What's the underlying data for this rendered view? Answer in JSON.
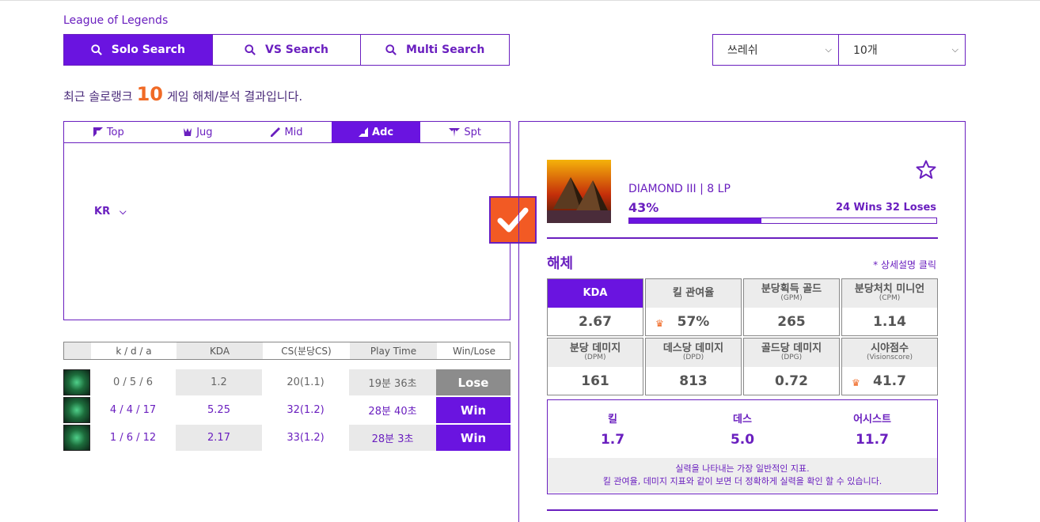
{
  "app": {
    "title": "League of Legends"
  },
  "modes": [
    {
      "label": "Solo Search",
      "active": true
    },
    {
      "label": "VS Search",
      "active": false
    },
    {
      "label": "Multi Search",
      "active": false
    }
  ],
  "filters": {
    "queue": "쓰레쉬",
    "count": "10개"
  },
  "summary": {
    "prefix": "최근 솔로랭크",
    "count": "10",
    "suffix": "게임 해체/분석 결과입니다."
  },
  "lanes": [
    {
      "label": "Top",
      "active": false
    },
    {
      "label": "Jug",
      "active": false
    },
    {
      "label": "Mid",
      "active": false
    },
    {
      "label": "Adc",
      "active": true
    },
    {
      "label": "Spt",
      "active": false
    }
  ],
  "region": "KR",
  "matches": {
    "headers": [
      "k / d / a",
      "KDA",
      "CS(분당CS)",
      "Play Time",
      "Win/Lose"
    ],
    "rows": [
      {
        "kda_line": "0 / 5 / 6",
        "kda": "1.2",
        "cs": "20(1.1)",
        "time": "19분 36초",
        "result": "Lose"
      },
      {
        "kda_line": "4 / 4 / 17",
        "kda": "5.25",
        "cs": "32(1.2)",
        "time": "28분 40초",
        "result": "Win"
      },
      {
        "kda_line": "1 / 6 / 12",
        "kda": "2.17",
        "cs": "33(1.2)",
        "time": "28분 3초",
        "result": "Win"
      }
    ]
  },
  "profile": {
    "rank": "DIAMOND III | 8 LP",
    "winrate_label": "43%",
    "winrate": 0.43,
    "record": "24 Wins 32 Loses"
  },
  "breakdown": {
    "title": "해체",
    "link": "* 상세설명 클릭",
    "stats": [
      {
        "label": "KDA",
        "sub": "",
        "value": "2.67",
        "crown": false,
        "active": true
      },
      {
        "label": "킬 관여율",
        "sub": "",
        "value": "57%",
        "crown": true,
        "active": false
      },
      {
        "label": "분당획득 골드",
        "sub": "(GPM)",
        "value": "265",
        "crown": false,
        "active": false
      },
      {
        "label": "분당처치 미니언",
        "sub": "(CPM)",
        "value": "1.14",
        "crown": false,
        "active": false
      },
      {
        "label": "분당 데미지",
        "sub": "(DPM)",
        "value": "161",
        "crown": false,
        "active": false
      },
      {
        "label": "데스당 데미지",
        "sub": "(DPD)",
        "value": "813",
        "crown": false,
        "active": false
      },
      {
        "label": "골드당 데미지",
        "sub": "(DPG)",
        "value": "0.72",
        "crown": false,
        "active": false
      },
      {
        "label": "시야점수",
        "sub": "(Visionscore)",
        "value": "41.7",
        "crown": true,
        "active": false
      }
    ],
    "kda_detail": {
      "kills_label": "킬",
      "kills": "1.7",
      "deaths_label": "데스",
      "deaths": "5.0",
      "assists_label": "어시스트",
      "assists": "11.7",
      "note_line1": "실력을 나타내는 가장 일반적인 지표.",
      "note_line2": "킬 관여율, 데미지 지표와 같이 보면 더 정확하게 실력을 확인 할 수 있습니다."
    }
  },
  "colors": {
    "accent": "#6a14e0",
    "orange": "#f25a24",
    "lose": "#8c8c8c"
  }
}
